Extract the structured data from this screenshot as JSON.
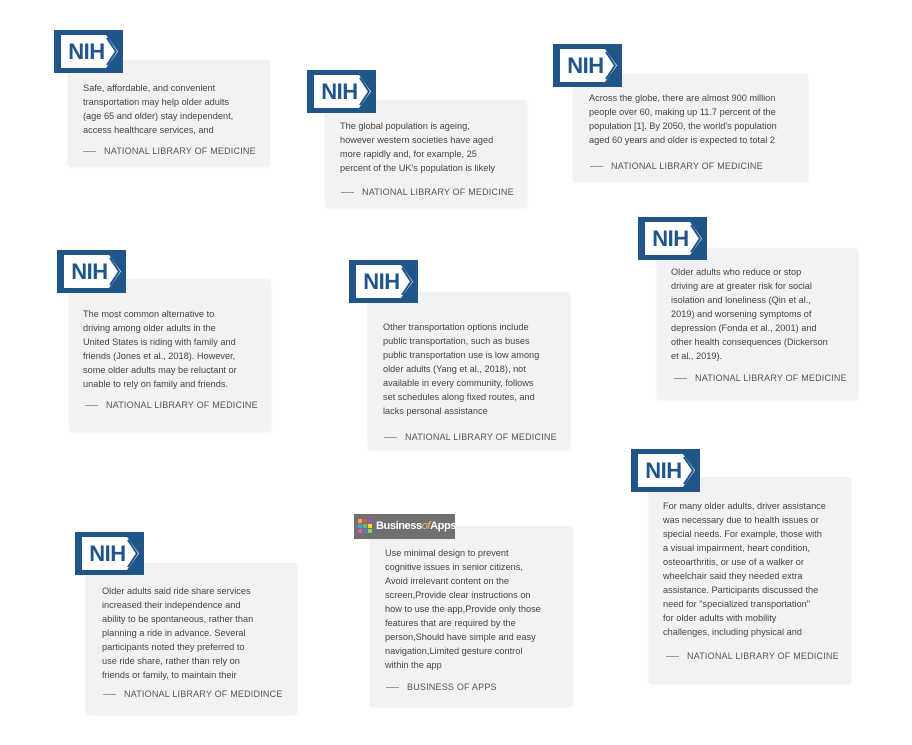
{
  "colors": {
    "nih_blue": "#20558a",
    "card_bg": "#f2f2f2",
    "boa_bg": "#707070"
  },
  "cards": [
    {
      "logo": "NIH",
      "text": "Safe, affordable, and convenient\ntransportation may help older adults\n(age 65 and older) stay independent,\naccess healthcare services, and",
      "source": "NATIONAL LIBRARY OF MEDICINE"
    },
    {
      "logo": "NIH",
      "text": "The global population is ageing,\nhowever western societies have aged\nmore rapidly and, for example, 25\npercent of the UK's population is likely",
      "source": "NATIONAL LIBRARY OF MEDICINE"
    },
    {
      "logo": "NIH",
      "text": "Across the globe, there are almost 900 million\npeople over 60, making up 11.7 percent of the\npopulation [1]. By 2050, the world's population\naged 60 years and older is expected to total 2",
      "source": "NATIONAL LIBRARY OF MEDICINE"
    },
    {
      "logo": "NIH",
      "text": "The most common alternative to\ndriving among older adults in the\nUnited States is riding with family and\nfriends (Jones et al., 2018). However,\nsome older adults may be reluctant or\nunable to rely on family and friends.",
      "source": "NATIONAL LIBRARY OF MEDICINE"
    },
    {
      "logo": "NIH",
      "text": "Other transportation options include\npublic transportation, such as buses\npublic transportation use is low among\nolder adults (Yang et al., 2018), not\navailable in every community, follows\nset schedules along fixed routes, and\nlacks personal assistance",
      "source": "NATIONAL LIBRARY OF MEDICINE"
    },
    {
      "logo": "NIH",
      "text": "Older adults who reduce or stop\ndriving are at greater risk for social\nisolation and loneliness (Qin et al.,\n2019) and worsening symptoms of\ndepression (Fonda et al., 2001) and\nother health consequences (Dickerson\net al., 2019).",
      "source": "NATIONAL LIBRARY OF MEDICINE"
    },
    {
      "logo": "NIH",
      "text": "Older adults said ride share services\nincreased their independence and\nability to be spontaneous, rather than\nplanning a ride in advance. Several\nparticipants noted they preferred to\nuse ride share, rather than rely on\nfriends or family, to maintain their",
      "source": "NATIONAL LIBRARY OF MEDIDINCE"
    },
    {
      "logo": "Business of Apps",
      "logo_parts": [
        "Business",
        "of",
        "Apps"
      ],
      "text": "Use minimal design to prevent\ncognitive issues in senior citizens,\nAvoid irrelevant content on the\nscreen,Provide clear instructions on\nhow to use the app,Provide only those\nfeatures that are required by the\nperson,Should have simple and easy\nnavigation,Limited gesture control\nwithin the app",
      "source": "BUSINESS OF APPS"
    },
    {
      "logo": "NIH",
      "text": "For many older adults, driver assistance\nwas necessary due to health issues or\nspecial needs. For example, those with\na visual impairment, heart condition,\nosteoarthritis, or use of a walker or\nwheelchair said they needed extra\nassistance. Participants discussed the\nneed for \"specialized transportation\"\nfor older adults with mobility\nchallenges, including physical and",
      "source": "NATIONAL LIBRARY OF MEDICINE"
    }
  ]
}
